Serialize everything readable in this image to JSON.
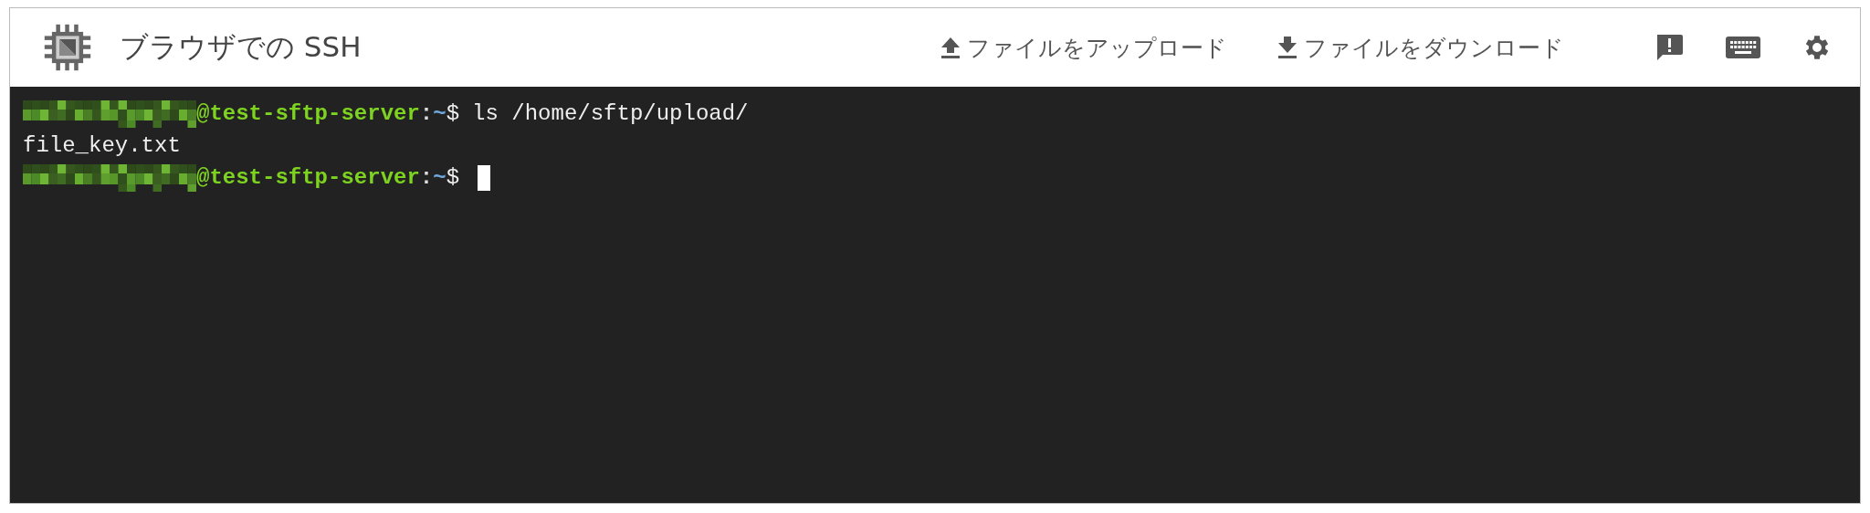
{
  "header": {
    "title": "ブラウザでの SSH",
    "actions": [
      {
        "kind": "upload",
        "label": "ファイルをアップロード"
      },
      {
        "kind": "download",
        "label": "ファイルをダウンロード"
      }
    ],
    "icon_buttons": [
      {
        "kind": "feedback"
      },
      {
        "kind": "keyboard"
      },
      {
        "kind": "settings"
      }
    ]
  },
  "terminal": {
    "lines": [
      {
        "kind": "prompt",
        "redacted_user": true,
        "host": "@test-sftp-server",
        "separator": ":",
        "path": "~",
        "symbol": "$",
        "command": "ls /home/sftp/upload/",
        "cursor": false
      },
      {
        "kind": "output",
        "text": "file_key.txt"
      },
      {
        "kind": "prompt",
        "redacted_user": true,
        "host": "@test-sftp-server",
        "separator": ":",
        "path": "~",
        "symbol": "$",
        "cursor": true
      }
    ]
  }
}
